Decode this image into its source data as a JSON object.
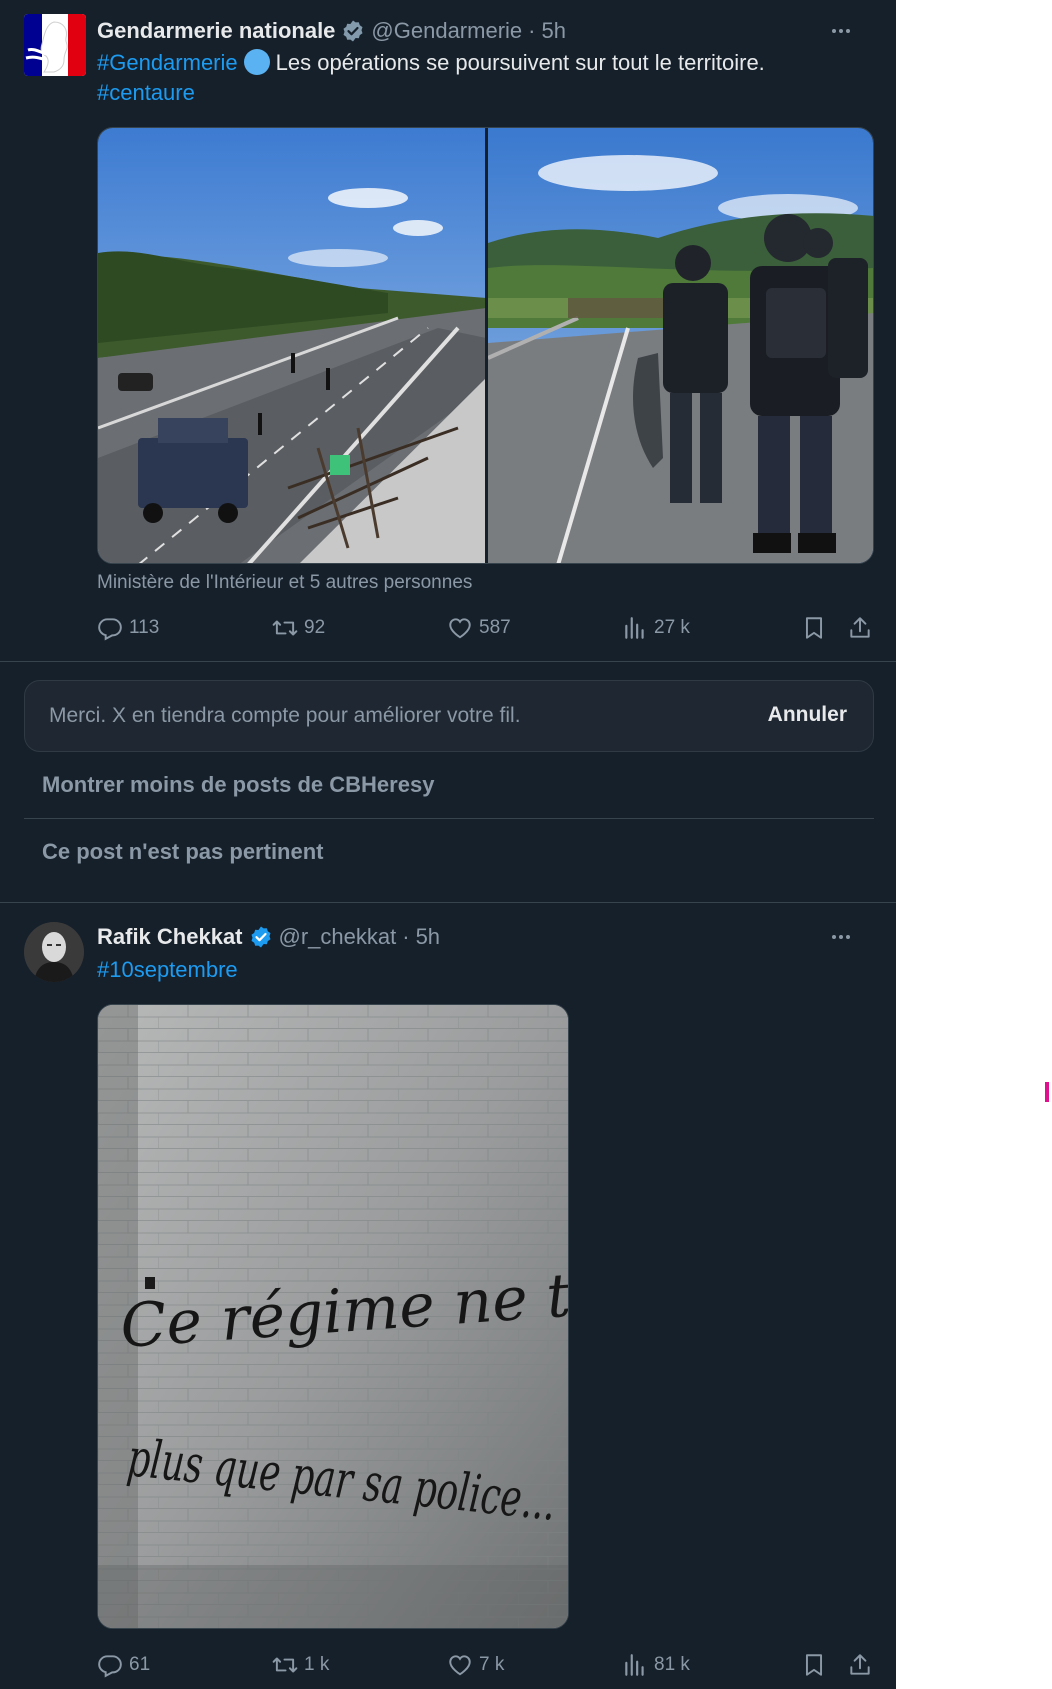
{
  "post1": {
    "author": "Gendarmerie nationale",
    "handle": "@Gendarmerie",
    "separator": "·",
    "time": "5h",
    "hashtag1": "#Gendarmerie",
    "text": "Les opérations se poursuivent sur tout le territoire.",
    "hashtag2": "#centaure",
    "tagged": "Ministère de l'Intérieur et 5 autres personnes",
    "stats": {
      "replies": "113",
      "reposts": "92",
      "likes": "587",
      "views": "27 k"
    }
  },
  "feedback": {
    "message": "Merci. X en tiendra compte pour améliorer votre fil.",
    "undo_label": "Annuler",
    "option1": "Montrer moins de posts de CBHeresy",
    "option2": "Ce post n'est pas pertinent"
  },
  "post2": {
    "author": "Rafik Chekkat",
    "handle": "@r_chekkat",
    "separator": "·",
    "time": "5h",
    "hashtag": "#10septembre",
    "graffiti_line1": "Ce régime ne tient",
    "graffiti_line2": "plus que par sa police...",
    "stats": {
      "replies": "61",
      "reposts": "1 k",
      "likes": "7 k",
      "views": "81 k"
    }
  },
  "colors": {
    "background": "#15202b",
    "text": "#e7e9ea",
    "muted": "#8b98a5",
    "accent": "#1d9bf0",
    "border": "#38444d"
  },
  "icons": [
    "verified-badge-icon",
    "more-icon",
    "reply-icon",
    "repost-icon",
    "like-icon",
    "views-icon",
    "bookmark-icon",
    "share-icon"
  ]
}
